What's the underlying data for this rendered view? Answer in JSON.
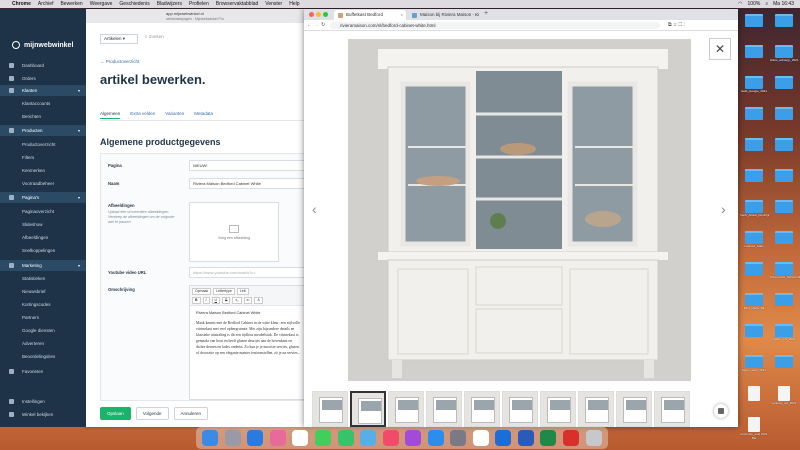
{
  "menubar": {
    "app": "Chrome",
    "items": [
      "Archief",
      "Bewerken",
      "Weergave",
      "Geschiedenis",
      "Bladwijzers",
      "Profielen",
      "Browservaktabblad",
      "Venster",
      "Help"
    ],
    "clock": "Ma 16:43",
    "battery": "100%"
  },
  "back_browser": {
    "url": "app.mijnwebwinkel.nl",
    "tab_caption": "webwinkelpagen - Mijnwebwinkel Pro"
  },
  "sidebar": {
    "logo": "mijnwebwinkel",
    "items": [
      {
        "label": "Dashboard",
        "type": "main"
      },
      {
        "label": "Orders",
        "type": "main"
      },
      {
        "label": "Klanten",
        "type": "main",
        "expanded": true
      },
      {
        "label": "Klantaccounts",
        "type": "sub"
      },
      {
        "label": "Berichten",
        "type": "sub"
      },
      {
        "label": "Producten",
        "type": "main",
        "expanded": true
      },
      {
        "label": "Productoverzicht",
        "type": "sub"
      },
      {
        "label": "Filters",
        "type": "sub"
      },
      {
        "label": "Kenmerken",
        "type": "sub"
      },
      {
        "label": "Voorraadbeheer",
        "type": "sub"
      },
      {
        "label": "Pagina's",
        "type": "main",
        "expanded": true
      },
      {
        "label": "Paginaoverzicht",
        "type": "sub"
      },
      {
        "label": "Slideshow",
        "type": "sub"
      },
      {
        "label": "Afbeeldingen",
        "type": "sub"
      },
      {
        "label": "Snelkoppelingen",
        "type": "sub"
      },
      {
        "label": "Marketing",
        "type": "main",
        "expanded": true
      },
      {
        "label": "Statistieken",
        "type": "sub"
      },
      {
        "label": "Nieuwsbrief",
        "type": "sub"
      },
      {
        "label": "Kortingscodes",
        "type": "sub"
      },
      {
        "label": "Partners",
        "type": "sub"
      },
      {
        "label": "Google diensten",
        "type": "sub"
      },
      {
        "label": "Adverteren",
        "type": "sub"
      },
      {
        "label": "Beoordelingsites",
        "type": "sub"
      },
      {
        "label": "Favorieten",
        "type": "main"
      },
      {
        "label": "Instellingen",
        "type": "main"
      },
      {
        "label": "Winkel bekijken",
        "type": "main"
      }
    ]
  },
  "editor_page": {
    "search_scope": "Artikelen",
    "search_placeholder": "Zoeken",
    "breadcrumb": "← Productoverzicht",
    "title": "artikel bewerken.",
    "tabs": [
      "Algemeen",
      "Extra velden",
      "Varianten",
      "Metadata"
    ],
    "active_tab": "Algemeen",
    "section_title": "Algemene productgegevens",
    "fields": {
      "pagina_label": "Pagina",
      "pagina_value": "NIEUW!",
      "naam_label": "Naam",
      "naam_value": "Riviera Maison Bedford Cabinet White",
      "afbeeldingen_label": "Afbeeldingen",
      "afbeeldingen_help": "Upload één of meerdere afbeeldingen. Versleep de afbeeldingen om de volgorde aan te passen",
      "image_placeholder": "Voeg een afbeelding",
      "youtube_label": "Youtube video URL",
      "youtube_placeholder": "https://www.youtube.com/watch?v=",
      "omschrijving_label": "Omschrijving"
    },
    "editor": {
      "format_select": "Opmaak",
      "font_select": "Lettertype",
      "size_select": "Lett",
      "toolbar_buttons": [
        "B",
        "I",
        "U",
        "S",
        "x₂",
        "x²",
        "A"
      ],
      "heading_line": "Riviera Maison Bedford Cabinet White",
      "body": "Maak kennis met de Bedford Cabinet in de witte kleur: een stijlvolle vitrinekast met veel opbergruimte. Met zijn bijzondere details en klassieke uitstraling is dit een tijdloos meubelstuk. De vitrinekast is gemaakt van hout en heeft glazen deurtjes aan de bovenkant en dichte deuren en lades onderin. Zo kun je je mooiste servies, glazen of decoratie op een elegante manier tentoonstellen, zó je na servies..."
    },
    "buttons": {
      "save": "Opslaan",
      "next": "Volgende",
      "cancel": "Annuleren"
    }
  },
  "front_browser": {
    "tabs": [
      {
        "label": "Buffetkast Bedford",
        "active": true,
        "close": "×"
      },
      {
        "label": "Maison bij Riviera Maison - Ki",
        "active": false,
        "close": "×"
      }
    ],
    "new_tab": "+",
    "url": "rivieramaison.com/nl/bedford-cabinet-white.html",
    "nav": {
      "back": "←",
      "forward": "→",
      "reload": "↻"
    },
    "lightbox": {
      "close": "✕",
      "prev": "‹",
      "next": "›",
      "thumbnail_count": 10,
      "selected_thumbnail": 1
    }
  },
  "desktop_icons": [
    {
      "label": "",
      "kind": "folder"
    },
    {
      "label": "",
      "kind": "folder"
    },
    {
      "label": "",
      "kind": "folder"
    },
    {
      "label": "Hikus_achtergr_2021",
      "kind": "folder"
    },
    {
      "label": "Geld_Google_2021",
      "kind": "folder"
    },
    {
      "label": "",
      "kind": "folder"
    },
    {
      "label": "",
      "kind": "folder"
    },
    {
      "label": "",
      "kind": "folder"
    },
    {
      "label": "",
      "kind": "folder"
    },
    {
      "label": "",
      "kind": "folder"
    },
    {
      "label": "",
      "kind": "folder"
    },
    {
      "label": "",
      "kind": "folder"
    },
    {
      "label": "Verdi_Artikel_Kleurrijk",
      "kind": "folder"
    },
    {
      "label": "",
      "kind": "folder"
    },
    {
      "label": "Laposta_Stats",
      "kind": "folder"
    },
    {
      "label": "",
      "kind": "folder"
    },
    {
      "label": "",
      "kind": "folder"
    },
    {
      "label": "Screenshot_Schermafbeelding",
      "kind": "folder"
    },
    {
      "label": "RTH_Maria_Ba",
      "kind": "folder"
    },
    {
      "label": "",
      "kind": "folder"
    },
    {
      "label": "",
      "kind": "folder"
    },
    {
      "label": "Cijfers_juni_2021",
      "kind": "folder"
    },
    {
      "label": "Eigen_werk_2021",
      "kind": "folder"
    },
    {
      "label": "",
      "kind": "folder"
    },
    {
      "label": "",
      "kind": "doc"
    },
    {
      "label": "verkoop_opt_2021",
      "kind": "doc"
    },
    {
      "label": "annumbe_exel 2021 Bla",
      "kind": "doc"
    }
  ],
  "dock": {
    "apps": [
      "finder",
      "launchpad",
      "safari",
      "photos",
      "calendar",
      "messages",
      "facetime",
      "maps",
      "music",
      "podcasts",
      "app-store",
      "system-preferences",
      "chrome",
      "outlook",
      "word",
      "excel",
      "acrobat",
      "trash"
    ]
  },
  "colors": {
    "sidebar_bg": "#1e3348",
    "accent_green": "#19b36b",
    "link_blue": "#3a6aa0"
  }
}
